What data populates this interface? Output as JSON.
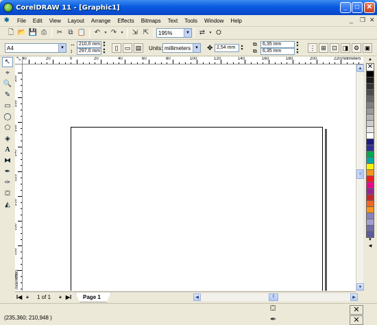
{
  "window": {
    "title": "CorelDRAW 11 - [Graphic1]",
    "controls": {
      "minimize": "_",
      "maximize": "□",
      "close": "✕"
    }
  },
  "menubar": {
    "items": [
      "File",
      "Edit",
      "View",
      "Layout",
      "Arrange",
      "Effects",
      "Bitmaps",
      "Text",
      "Tools",
      "Window",
      "Help"
    ],
    "doc_controls": {
      "minimize": "_",
      "restore": "❐",
      "close": "✕"
    }
  },
  "standard_toolbar": {
    "zoom_value": "195%"
  },
  "property_bar": {
    "page_size": "A4",
    "width": "210,0 mm",
    "height": "297,0 mm",
    "units_label": "Units:",
    "units_value": "millimeters",
    "nudge": "2,54 mm",
    "dup_x": "6,35 mm",
    "dup_y": "6,35 mm"
  },
  "rulers": {
    "horizontal_labels": [
      "40",
      "20",
      "0",
      "20",
      "40",
      "60",
      "80",
      "100",
      "120",
      "140",
      "160",
      "180",
      "200",
      "220"
    ],
    "horizontal_unit": "millimeters",
    "vertical_labels": [
      "300",
      "280",
      "260",
      "240",
      "220",
      "200",
      "180",
      "160",
      "140"
    ],
    "vertical_unit": "millimeters"
  },
  "palette": {
    "colors": [
      "#000000",
      "#1a1a1a",
      "#333333",
      "#4d4d4d",
      "#666666",
      "#808080",
      "#999999",
      "#b3b3b3",
      "#cccccc",
      "#e6e6e6",
      "#ffffff",
      "#1c1c7c",
      "#2e3192",
      "#00a651",
      "#00a99d",
      "#fff200",
      "#f7941d",
      "#ed1c24",
      "#ec008c",
      "#92278f",
      "#c1272d",
      "#f26522",
      "#f7941d",
      "#8781bd",
      "#a3a0cf",
      "#6f6fa8",
      "#5b5b9b"
    ]
  },
  "document_bar": {
    "page_count": "1 of 1",
    "page_tab": "Page 1"
  },
  "status": {
    "coordinates": "(235,360; 210,948 )"
  }
}
